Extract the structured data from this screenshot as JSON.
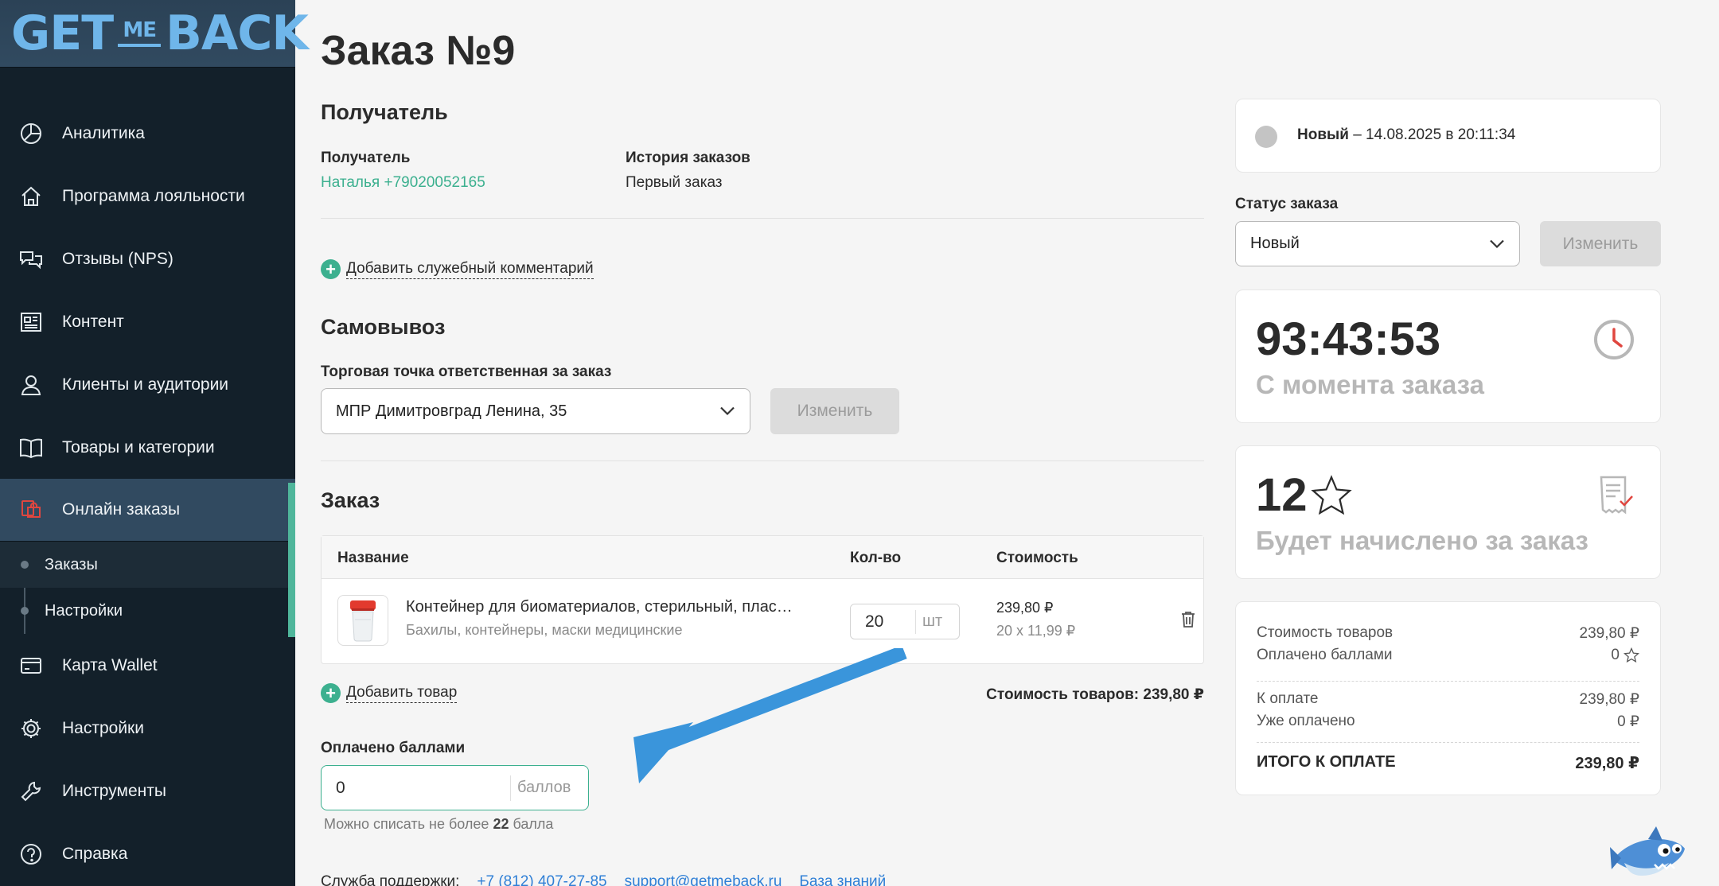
{
  "brand": {
    "logo_get": "GET",
    "logo_me": "ME",
    "logo_back": "BACK",
    "accent": "#3cb08f",
    "sidebar_bg": "#13202a"
  },
  "sidebar": {
    "items": [
      {
        "label": "Аналитика",
        "icon": "pie-chart-icon"
      },
      {
        "label": "Программа лояльности",
        "icon": "home-icon"
      },
      {
        "label": "Отзывы (NPS)",
        "icon": "chat-bubbles-icon"
      },
      {
        "label": "Контент",
        "icon": "newspaper-icon"
      },
      {
        "label": "Клиенты и аудитории",
        "icon": "user-icon"
      },
      {
        "label": "Товары и категории",
        "icon": "book-icon"
      },
      {
        "label": "Онлайн заказы",
        "icon": "cart-icon"
      },
      {
        "label": "Карта Wallet",
        "icon": "card-icon"
      },
      {
        "label": "Настройки",
        "icon": "gear-icon"
      },
      {
        "label": "Инструменты",
        "icon": "wrench-icon"
      },
      {
        "label": "Справка",
        "icon": "help-icon"
      }
    ],
    "sub_items": [
      {
        "label": "Заказы"
      },
      {
        "label": "Настройки"
      }
    ]
  },
  "page": {
    "title": "Заказ №9"
  },
  "recipient": {
    "section_title": "Получатель",
    "recipient_label": "Получатель",
    "recipient_value": "Наталья +79020052165",
    "history_label": "История заказов",
    "history_value": "Первый заказ",
    "add_comment": "Добавить служебный комментарий"
  },
  "pickup": {
    "section_title": "Самовывоз",
    "store_label": "Торговая точка ответственная за заказ",
    "store_value": "МПР Димитровград Ленина, 35",
    "change_button": "Изменить"
  },
  "order": {
    "section_title": "Заказ",
    "columns": {
      "name": "Название",
      "qty": "Кол-во",
      "price": "Стоимость"
    },
    "items": [
      {
        "name": "Контейнер для биоматериалов, стерильный, плас…",
        "category": "Бахилы, контейнеры, маски медицинские",
        "qty": "20",
        "unit": "шт",
        "total": "239,80 ₽",
        "calc": "20 x 11,99 ₽"
      }
    ],
    "add_item": "Добавить товар",
    "goods_total": "Стоимость товаров: 239,80 ₽",
    "points_label": "Оплачено баллами",
    "points_value": "0",
    "points_unit": "баллов",
    "points_hint_prefix": "Можно списать не более",
    "points_hint_number": "22",
    "points_hint_suffix": "балла"
  },
  "footer": {
    "support_label": "Служба поддержки:",
    "phone": "+7 (812) 407-27-85",
    "email": "support@getmeback.ru",
    "kb": "База знаний"
  },
  "right": {
    "status_name": "Новый",
    "status_date": " – 14.08.2025 в 20:11:34",
    "status_label": "Статус заказа",
    "status_select": "Новый",
    "status_change": "Изменить",
    "timer_value": "93:43:53",
    "timer_sub": "С момента заказа",
    "bonus_value": "12",
    "bonus_sub": "Будет начислено за заказ",
    "summary": {
      "goods_label": "Стоимость товаров",
      "goods_value": "239,80 ₽",
      "paid_points_label": "Оплачено баллами",
      "paid_points_value": "0",
      "to_pay_label": "К оплате",
      "to_pay_value": "239,80 ₽",
      "already_paid_label": "Уже оплачено",
      "already_paid_value": "0 ₽",
      "total_label": "ИТОГО К ОПЛАТЕ",
      "total_value": "239,80 ₽"
    }
  }
}
